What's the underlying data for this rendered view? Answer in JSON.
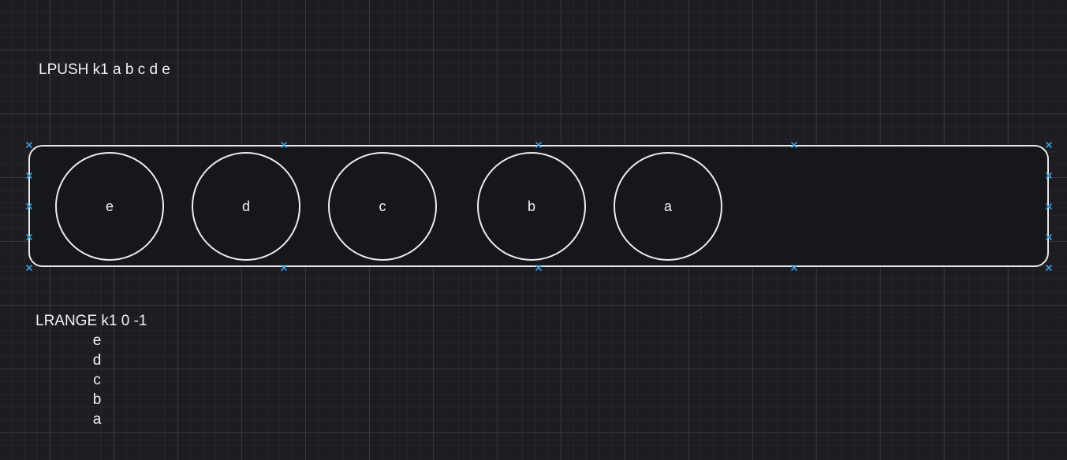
{
  "commands": {
    "lpush": "LPUSH k1 a b c d e",
    "lrange": "LRANGE k1 0 -1"
  },
  "list": {
    "elements": [
      "e",
      "d",
      "c",
      "b",
      "a"
    ]
  },
  "result": [
    "e",
    "d",
    "c",
    "b",
    "a"
  ],
  "colors": {
    "background": "#1c1c22",
    "stroke": "#e8e8e8",
    "handle": "#3d9fdc"
  }
}
